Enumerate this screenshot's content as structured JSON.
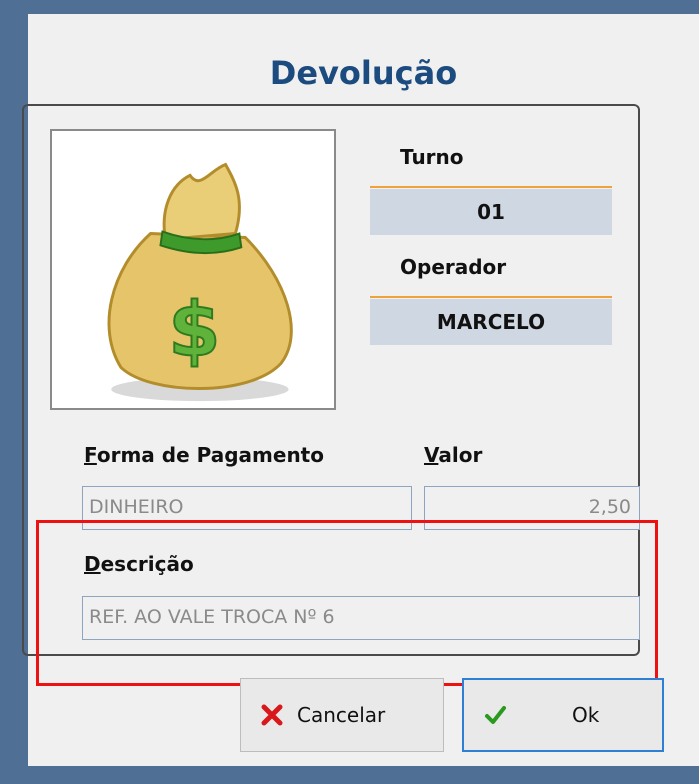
{
  "dialog": {
    "title": "Devolução"
  },
  "info": {
    "turno_label": "Turno",
    "turno_value": "01",
    "operador_label": "Operador",
    "operador_value": "MARCELO"
  },
  "payment": {
    "forma_label_first": "F",
    "forma_label_rest": "orma de Pagamento",
    "forma_value": "DINHEIRO",
    "valor_label_first": "V",
    "valor_label_rest": "alor",
    "valor_value": "2,50"
  },
  "description": {
    "label_first": "D",
    "label_rest": "escrição",
    "value": "REF. AO VALE TROCA Nº 6"
  },
  "buttons": {
    "cancel_label": "Cancelar",
    "ok_label": "Ok"
  },
  "icons": {
    "image": "money-bag-icon",
    "cancel": "x-icon",
    "ok": "check-icon"
  },
  "colors": {
    "title": "#1c4b7f",
    "accent": "#f0a23a",
    "highlight": "#ee1111",
    "readonly_bg": "#cfd7e2"
  }
}
